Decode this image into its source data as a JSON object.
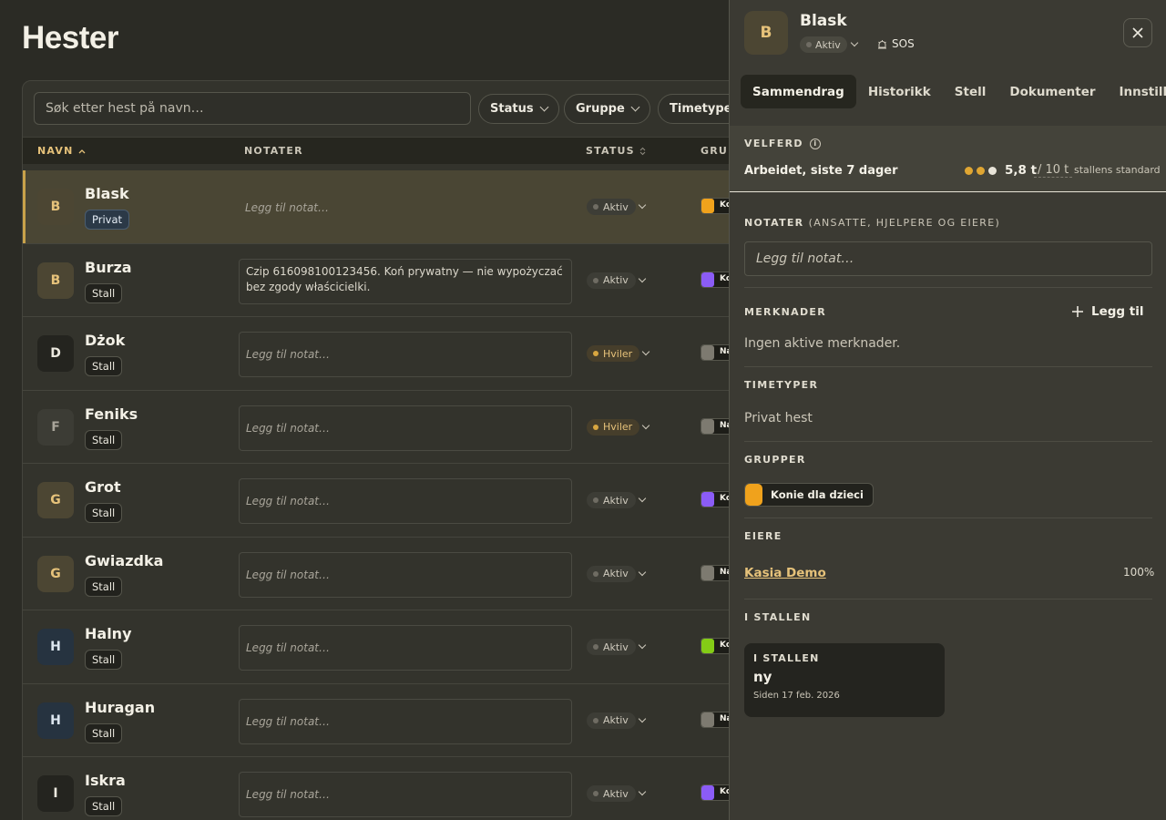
{
  "page": {
    "title": "Hester"
  },
  "search": {
    "placeholder": "Søk etter hest på navn…"
  },
  "filters": [
    "Status",
    "Gruppe",
    "Timetyper"
  ],
  "columns": {
    "name": "NAVN",
    "notes": "NOTATER",
    "status": "STATUS",
    "groups": "GRUP"
  },
  "note_placeholder": "Legg til notat…",
  "horses": [
    {
      "initial": "B",
      "name": "Blask",
      "tag": "Privat",
      "note": "",
      "status": "Aktiv",
      "group_color": "#f0a21c",
      "group_abbr": "Ko"
    },
    {
      "initial": "B",
      "name": "Burza",
      "tag": "Stall",
      "note": "Czip 616098100123456. Koń prywatny — nie wypożyczać bez zgody właścicielki.",
      "status": "Aktiv",
      "group_color": "#8b5cf6",
      "group_abbr": "Ko"
    },
    {
      "initial": "D",
      "name": "Dżok",
      "tag": "Stall",
      "note": "",
      "status": "Hviler",
      "group_color": "#7d7a70",
      "group_abbr": "Na"
    },
    {
      "initial": "F",
      "name": "Feniks",
      "tag": "Stall",
      "note": "",
      "status": "Hviler",
      "group_color": "#7d7a70",
      "group_abbr": "Na"
    },
    {
      "initial": "G",
      "name": "Grot",
      "tag": "Stall",
      "note": "",
      "status": "Aktiv",
      "group_color": "#8b5cf6",
      "group_abbr": "Ko"
    },
    {
      "initial": "G",
      "name": "Gwiazdka",
      "tag": "Stall",
      "note": "",
      "status": "Aktiv",
      "group_color": "#7d7a70",
      "group_abbr": "Na"
    },
    {
      "initial": "H",
      "name": "Halny",
      "tag": "Stall",
      "note": "",
      "status": "Aktiv",
      "group_color": "#84cc16",
      "group_abbr": "Ko"
    },
    {
      "initial": "H",
      "name": "Huragan",
      "tag": "Stall",
      "note": "",
      "status": "Aktiv",
      "group_color": "#7d7a70",
      "group_abbr": "Na"
    },
    {
      "initial": "I",
      "name": "Iskra",
      "tag": "Stall",
      "note": "",
      "status": "Aktiv",
      "group_color": "#8b5cf6",
      "group_abbr": "Ko"
    }
  ],
  "panel": {
    "initial": "B",
    "name": "Blask",
    "status": "Aktiv",
    "sos": "SOS",
    "tabs": [
      "Sammendrag",
      "Historikk",
      "Stell",
      "Dokumenter",
      "Innstillinger"
    ],
    "welfare": {
      "title": "VELFERD",
      "label": "Arbeidet, siste 7 dager",
      "value": "5,8 t",
      "goal": "/ 10 t",
      "standard": "stallens standard",
      "dot_colors": [
        "#e0a632",
        "#e0a632",
        "#e8e4d8"
      ]
    },
    "notes": {
      "title": "NOTATER",
      "subtitle": "(ANSATTE, HJELPERE OG EIERE)",
      "placeholder": "Legg til notat…"
    },
    "remarks": {
      "title": "MERKNADER",
      "add_label": "Legg til",
      "empty": "Ingen aktive merknader."
    },
    "hour_types": {
      "title": "TIMETYPER",
      "value": "Privat hest"
    },
    "groups": {
      "title": "GRUPPER",
      "chip": "Konie dla dzieci",
      "chip_color": "#f0a21c"
    },
    "owners": {
      "title": "EIERE",
      "name": "Kasia Demo",
      "share": "100%"
    },
    "in_stable": {
      "title": "I STALLEN",
      "card_title": "I STALLEN",
      "value": "ny",
      "since": "Siden 17 feb. 2026"
    }
  },
  "colors": {
    "accent": "#e6c27a",
    "selected_row": "#4a4634",
    "rest_status": "#d8a640"
  }
}
